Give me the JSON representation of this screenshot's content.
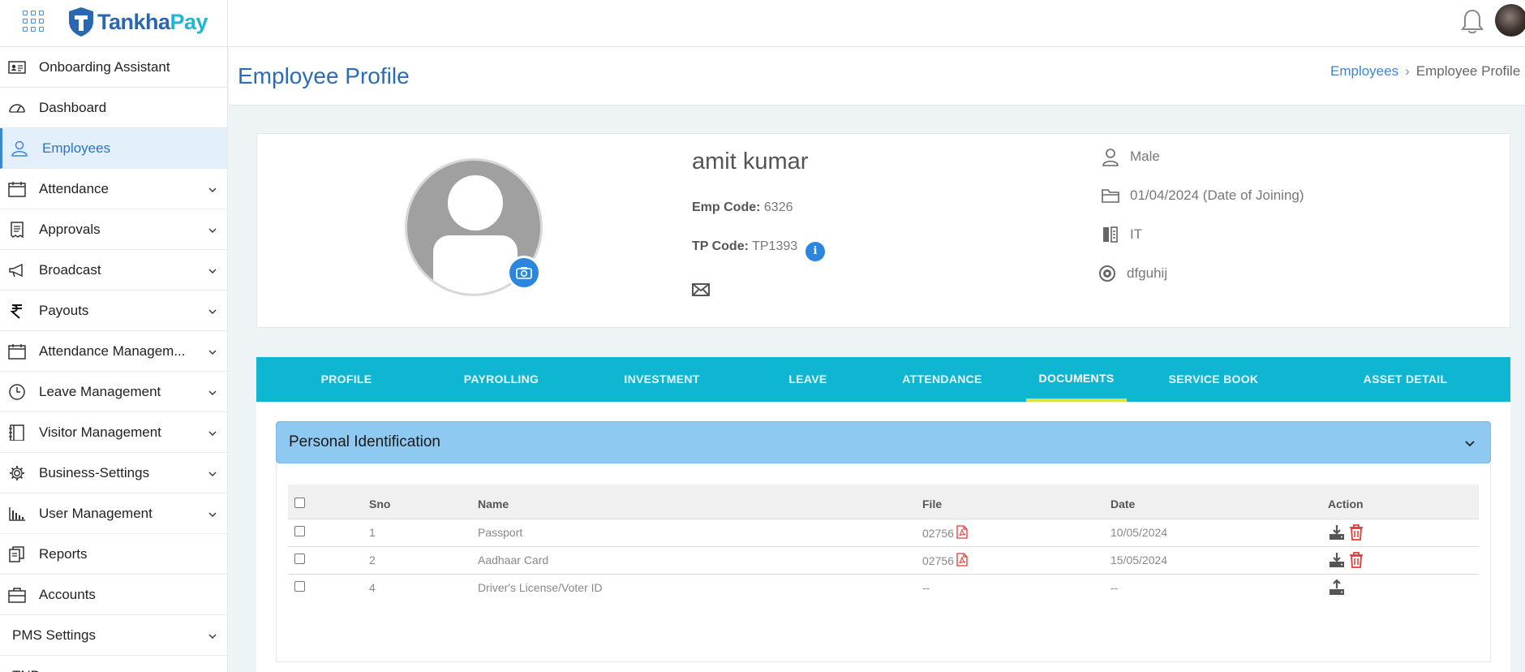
{
  "brand": {
    "name_part1": "Tankha",
    "name_part2": "Pay"
  },
  "sidebar": {
    "items": [
      {
        "label": "Onboarding Assistant",
        "icon": "id-card-icon",
        "has_chevron": false
      },
      {
        "label": "Dashboard",
        "icon": "gauge-icon",
        "has_chevron": false
      },
      {
        "label": "Employees",
        "icon": "user-icon",
        "has_chevron": false,
        "active": true
      },
      {
        "label": "Attendance",
        "icon": "calendar-icon",
        "has_chevron": true
      },
      {
        "label": "Approvals",
        "icon": "receipt-icon",
        "has_chevron": true
      },
      {
        "label": "Broadcast",
        "icon": "megaphone-icon",
        "has_chevron": true
      },
      {
        "label": "Payouts",
        "icon": "rupee-icon",
        "has_chevron": true
      },
      {
        "label": "Attendance Managem...",
        "icon": "calendar-icon",
        "has_chevron": true
      },
      {
        "label": "Leave Management",
        "icon": "clock-icon",
        "has_chevron": true
      },
      {
        "label": "Visitor Management",
        "icon": "notebook-icon",
        "has_chevron": true
      },
      {
        "label": "Business-Settings",
        "icon": "gear-icon",
        "has_chevron": true
      },
      {
        "label": "User Management",
        "icon": "bar-chart-icon",
        "has_chevron": true
      },
      {
        "label": "Reports",
        "icon": "copy-icon",
        "has_chevron": false
      },
      {
        "label": "Accounts",
        "icon": "briefcase-icon",
        "has_chevron": false
      },
      {
        "label": "PMS Settings",
        "icon": "",
        "has_chevron": true
      },
      {
        "label": "TND",
        "icon": "",
        "has_chevron": false
      }
    ]
  },
  "header": {
    "title": "Employee Profile",
    "breadcrumb": {
      "link": "Employees",
      "current": "Employee Profile"
    }
  },
  "profile": {
    "name": "amit kumar",
    "emp_code_label": "Emp Code:",
    "emp_code": "6326",
    "tp_code_label": "TP Code:",
    "tp_code": "TP1393",
    "info_glyph": "i",
    "gender": "Male",
    "joining": "01/04/2024 (Date of Joining)",
    "department": "IT",
    "extra": "dfguhij"
  },
  "tabs": [
    {
      "label": "PROFILE",
      "active": false
    },
    {
      "label": "PAYROLLING",
      "active": false
    },
    {
      "label": "INVESTMENT",
      "active": false
    },
    {
      "label": "LEAVE",
      "active": false
    },
    {
      "label": "ATTENDANCE",
      "active": false
    },
    {
      "label": "DOCUMENTS",
      "active": true
    },
    {
      "label": "SERVICE BOOK",
      "active": false
    },
    {
      "label": "ASSET DETAIL",
      "active": false
    }
  ],
  "documents": {
    "section_title": "Personal Identification",
    "columns": {
      "sno": "Sno",
      "name": "Name",
      "file": "File",
      "date": "Date",
      "action": "Action"
    },
    "rows": [
      {
        "sno": "1",
        "name": "Passport",
        "file": "02756",
        "has_pdf": true,
        "date": "10/05/2024",
        "actions": [
          "download",
          "delete"
        ]
      },
      {
        "sno": "2",
        "name": "Aadhaar Card",
        "file": "02756",
        "has_pdf": true,
        "date": "15/05/2024",
        "actions": [
          "download",
          "delete"
        ]
      },
      {
        "sno": "4",
        "name": "Driver's License/Voter ID",
        "file": "--",
        "has_pdf": false,
        "date": "--",
        "actions": [
          "upload"
        ]
      }
    ]
  },
  "colors": {
    "accent": "#2a6db5",
    "tabs_bg": "#0fb6d2",
    "tab_active_underline": "#d6e24a",
    "accordion_bg": "#8ec9f2",
    "delete": "#e53935"
  }
}
